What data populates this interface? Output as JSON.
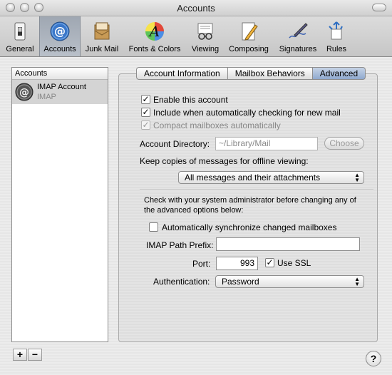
{
  "window": {
    "title": "Accounts"
  },
  "toolbar": {
    "items": [
      {
        "label": "General",
        "icon": "light-switch-icon"
      },
      {
        "label": "Accounts",
        "icon": "at-sign-icon"
      },
      {
        "label": "Junk Mail",
        "icon": "junk-mail-icon"
      },
      {
        "label": "Fonts & Colors",
        "icon": "font-palette-icon"
      },
      {
        "label": "Viewing",
        "icon": "glasses-letter-icon"
      },
      {
        "label": "Composing",
        "icon": "pencil-paper-icon"
      },
      {
        "label": "Signatures",
        "icon": "pen-signature-icon"
      },
      {
        "label": "Rules",
        "icon": "rules-arrows-icon"
      }
    ],
    "selected": "Accounts"
  },
  "accounts": {
    "header": "Accounts",
    "items": [
      {
        "name": "IMAP Account",
        "type": "IMAP"
      }
    ],
    "add_label": "+",
    "remove_label": "−"
  },
  "tabs": [
    {
      "label": "Account Information"
    },
    {
      "label": "Mailbox Behaviors"
    },
    {
      "label": "Advanced"
    }
  ],
  "advanced": {
    "enable_label": "Enable this account",
    "include_label": "Include when automatically checking for new mail",
    "compact_label": "Compact mailboxes automatically",
    "dir_label": "Account Directory:",
    "dir_value": "~/Library/Mail",
    "choose_label": "Choose",
    "keep_label": "Keep copies of messages for offline viewing:",
    "keep_value": "All messages and their attachments",
    "warning_line1": "Check with your system administrator before changing any of",
    "warning_line2": "the advanced options below:",
    "sync_label": "Automatically synchronize changed mailboxes",
    "prefix_label": "IMAP Path Prefix:",
    "prefix_value": "",
    "port_label": "Port:",
    "port_value": "993",
    "ssl_label": "Use SSL",
    "auth_label": "Authentication:",
    "auth_value": "Password",
    "check_mark": "✓"
  },
  "help": {
    "label": "?"
  }
}
